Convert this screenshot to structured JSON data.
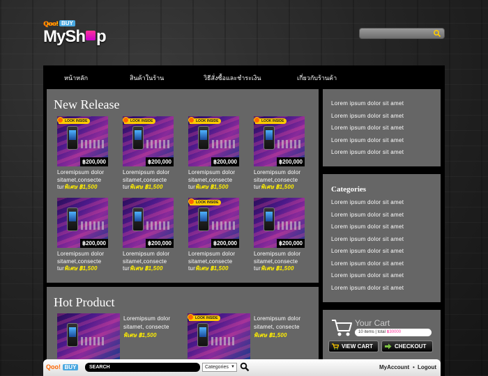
{
  "brand": {
    "badge_q": "Qoo!",
    "badge_buy": "BUY",
    "name_left": "MySh",
    "name_right": "p"
  },
  "nav": {
    "items": [
      {
        "label": "หน้าหลัก"
      },
      {
        "label": "สินค้าในร้าน"
      },
      {
        "label": "วิธีสั่งซื้อและชำระเงิน"
      },
      {
        "label": "เกี่ยวกับร้านค้า"
      }
    ]
  },
  "new_release": {
    "title": "New Release",
    "look_label": "LOOK INSIDE",
    "products": [
      {
        "price": "฿200,000",
        "desc": "Loremipsum dolor sitamet,consecte tur",
        "special": "พิเศษ ฿1,500",
        "look": true
      },
      {
        "price": "฿200,000",
        "desc": "Loremipsum dolor sitamet,consecte tur",
        "special": "พิเศษ ฿1,500",
        "look": true
      },
      {
        "price": "฿200,000",
        "desc": "Loremipsum dolor sitamet,consecte tur",
        "special": "พิเศษ ฿1,500",
        "look": true
      },
      {
        "price": "฿200,000",
        "desc": "Loremipsum dolor sitamet,consecte tur",
        "special": "พิเศษ ฿1,500",
        "look": true
      },
      {
        "price": "฿200,000",
        "desc": "Loremipsum dolor sitamet,consecte tur",
        "special": "พิเศษ ฿1,500",
        "look": false
      },
      {
        "price": "฿200,000",
        "desc": "Loremipsum dolor sitamet,consecte tur",
        "special": "พิเศษ ฿1,500",
        "look": false
      },
      {
        "price": "฿200,000",
        "desc": "Loremipsum dolor sitamet,consecte tur",
        "special": "พิเศษ ฿1,500",
        "look": true
      },
      {
        "price": "฿200,000",
        "desc": "Loremipsum dolor sitamet,consecte tur",
        "special": "พิเศษ ฿1,500",
        "look": false
      }
    ]
  },
  "hot_product": {
    "title": "Hot Product",
    "items": [
      {
        "desc1": "Loremipsum dolor",
        "desc2": "sitamet, consecte",
        "special": "พิเศษ ฿1,500",
        "look": false
      },
      {
        "desc1": "Loremipsum dolor",
        "desc2": "sitamet, consecte",
        "special": "พิเศษ ฿1,500",
        "look": true
      }
    ]
  },
  "side_links": {
    "items": [
      "Lorem ipsum dolor sit amet",
      "Lorem ipsum dolor sit amet",
      "Lorem ipsum dolor sit amet",
      "Lorem ipsum dolor sit amet",
      "Lorem ipsum dolor sit amet"
    ]
  },
  "categories": {
    "title": "Categories",
    "items": [
      "Lorem ipsum dolor sit amet",
      "Lorem ipsum dolor sit amet",
      "Lorem ipsum dolor sit amet",
      "Lorem ipsum dolor sit amet",
      "Lorem ipsum dolor sit amet",
      "Lorem ipsum dolor sit amet",
      "Lorem ipsum dolor sit amet",
      "Lorem ipsum dolor sit amet"
    ]
  },
  "cart": {
    "title": "Your Cart",
    "count": "10",
    "count_suffix": " items | total ",
    "total": "฿30000",
    "view_label": "VIEW CART",
    "checkout_label": "CHECKOUT"
  },
  "toolbar": {
    "logo_q": "Qoo!",
    "logo_buy": "BUY",
    "search_label": "SEARCH",
    "category_value": "Categories",
    "account_label": "MyAccount",
    "logout_label": "Logout"
  },
  "colors": {
    "panel": "#666666",
    "frame": "#000000",
    "special": "#ffee00",
    "accent_pink": "#ff3399"
  }
}
